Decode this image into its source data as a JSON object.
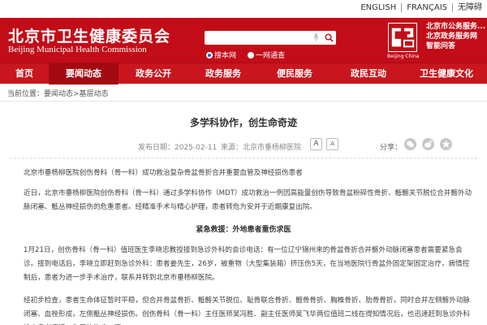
{
  "langs": [
    "ENGLISH",
    "FRANÇAIS",
    "无障碍"
  ],
  "header": {
    "logo_cn": "北京市卫生健康委员会",
    "logo_en": "Beijing Municipal Health Commission",
    "search_placeholder": "",
    "scope_options": [
      "搜本网",
      "一网通查"
    ],
    "seal_caption": "Beijing·China",
    "service_lines": [
      "北京市公务服务...",
      "北京政务服务网",
      "智能问答"
    ]
  },
  "nav": [
    "首页",
    "要闻动态",
    "政务公开",
    "政务服务",
    "便民服务",
    "政民互动",
    "卫生健康文化"
  ],
  "breadcrumb": "当前位置：要闻动态>基层动态",
  "article": {
    "title": "多学科协作，创生命奇迹",
    "date": "发布日期：2025-02-11",
    "source": "来源：北京市垂杨柳医院",
    "font_large": "A",
    "font_small": "A",
    "share_label": "分享："
  },
  "paragraphs": {
    "p1": "北京市垂杨柳医院创伤骨科（骨一科）成功救治复杂骨盆骨折合并重要血管及神经损伤患者",
    "p2": "近日，北京市垂杨柳医院创伤骨科（骨一科）通过多学科协作（MDT）成功救治一例因高能量创伤导致骨盆粉碎性骨折、骶髂关节脱位合并髂外动脉闭塞、骶丛神经损伤的危重患者。经精准手术与精心护理，患者转危为安并于近期康复出院。",
    "subheading": "紧急救援：外地患者重伤求医",
    "p3": "1月21日，创伤骨科（骨一科）值班医生李晓忠教授接到急诊外科的会诊电话：有一位辽宁锦州来的骨盆骨折合并髂外动脉闭塞患者需要紧急会诊。接到电话后，李晓立即赶到急诊外科：患者姜先生，26岁，被重物（大型集装箱）挤压伤5天，在当地医院行骨盆外固定架固定治疗，病情控制后，患者为进一步手术治疗，联系并转到北京市垂杨柳医院。",
    "p4": "经初步检查，患者生命体征暂时平稳，但合并骨盆骨折、骶髂关节脱位、耻骨联合骨折、髋骨骨折、胸椎骨折、肋骨骨折，同时合并左侧髂外动脉闭塞、血栓形成，左侧骶丛神经损伤。创伤骨科（骨一科）主任医师吴冯胜、副主任医师吴飞华两位值班二线在得知情况后，也迅速赶到急诊外科检查患者病情。为尽快治疗，李"
  }
}
